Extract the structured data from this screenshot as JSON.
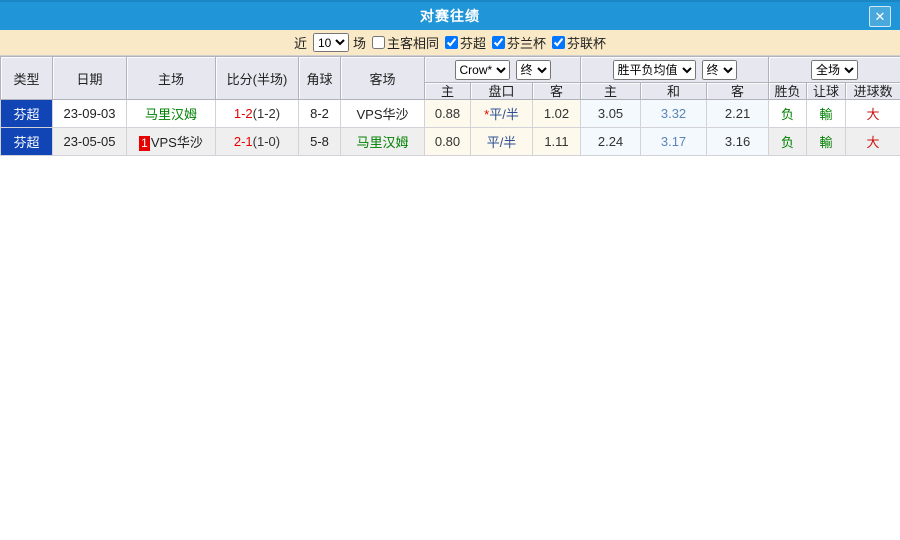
{
  "window": {
    "title": "对赛往绩",
    "close_glyph": "✕"
  },
  "filter": {
    "near_label": "近",
    "match_count": "10",
    "games_label": "场",
    "same_venue_label": "主客相同",
    "leagues": [
      {
        "label": "芬超",
        "checked": true
      },
      {
        "label": "芬兰杯",
        "checked": true
      },
      {
        "label": "芬联杯",
        "checked": true
      }
    ]
  },
  "colors": {
    "titlebar": "#2096d8",
    "league_cell": "#1144b4",
    "team_highlight": "#008000",
    "score": "#e60000",
    "handicap": "#2d4f93",
    "draw_odds": "#5c84b8"
  },
  "table": {
    "left_headers": [
      "类型",
      "日期",
      "主场",
      "比分(半场)",
      "角球",
      "客场"
    ],
    "groups": [
      {
        "select1": "Crow*",
        "select2": "终",
        "sub": [
          "主",
          "盘口",
          "客"
        ]
      },
      {
        "select1": "胜平负均值",
        "select2": "终",
        "sub": [
          "主",
          "和",
          "客"
        ]
      },
      {
        "select1": "全场",
        "sub": [
          "胜负",
          "让球",
          "进球数"
        ]
      }
    ],
    "rows": [
      {
        "league": "芬超",
        "date": "23-09-03",
        "home_badge": "",
        "home": "马里汉姆",
        "home_class": "team-green",
        "score": "1-2",
        "half": "(1-2)",
        "corners": "8-2",
        "away": "VPS华沙",
        "away_class": "team-dark",
        "asian_home": "0.88",
        "asian_star": "*",
        "asian_line": "平/半",
        "asian_away": "1.02",
        "odds_home": "3.05",
        "odds_draw": "3.32",
        "odds_away": "2.21",
        "result": "负",
        "asian_result": "輸",
        "goals": "大"
      },
      {
        "league": "芬超",
        "date": "23-05-05",
        "home_badge": "1",
        "home": "VPS华沙",
        "home_class": "team-dark",
        "score": "2-1",
        "half": "(1-0)",
        "corners": "5-8",
        "away": "马里汉姆",
        "away_class": "team-green",
        "asian_home": "0.80",
        "asian_star": "",
        "asian_line": "平/半",
        "asian_away": "1.11",
        "odds_home": "2.24",
        "odds_draw": "3.17",
        "odds_away": "3.16",
        "result": "负",
        "asian_result": "輸",
        "goals": "大"
      }
    ]
  }
}
